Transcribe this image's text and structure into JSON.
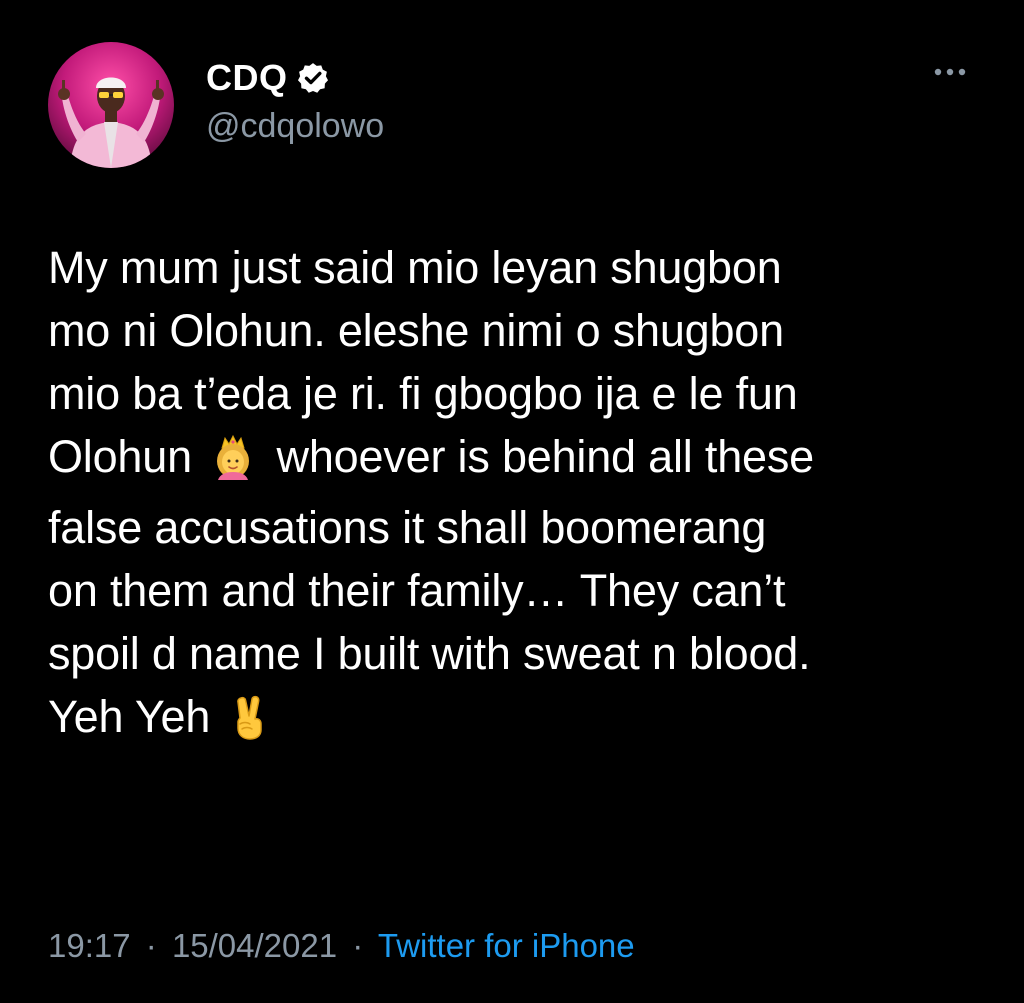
{
  "tweet": {
    "author": {
      "display_name": "CDQ",
      "handle": "@cdqolowo",
      "verified": true,
      "avatar": "profile-photo"
    },
    "more_icon": "ellipsis-icon",
    "lines": [
      "My mum just said mio leyan shugbon",
      "mo ni Olohun. eleshe nimi o shugbon",
      "mio ba t’eda je ri. fi gbogbo ija e le fun"
    ],
    "line4": {
      "before": "Olohun",
      "emoji": "princess-emoji",
      "after": "whoever is behind all these"
    },
    "lines_after": [
      "false accusations it shall boomerang",
      "on them and their family… They can’t",
      "spoil d name I built with sweat n blood."
    ],
    "last_line": {
      "text": "Yeh Yeh",
      "emoji": "victory-hand-emoji"
    },
    "meta": {
      "time": "19:17",
      "separator": "·",
      "date": "15/04/2021",
      "source": "Twitter for iPhone"
    }
  },
  "colors": {
    "background": "#000000",
    "text": "#ffffff",
    "secondary_text": "#8b98a5",
    "link": "#1d9bf0"
  }
}
